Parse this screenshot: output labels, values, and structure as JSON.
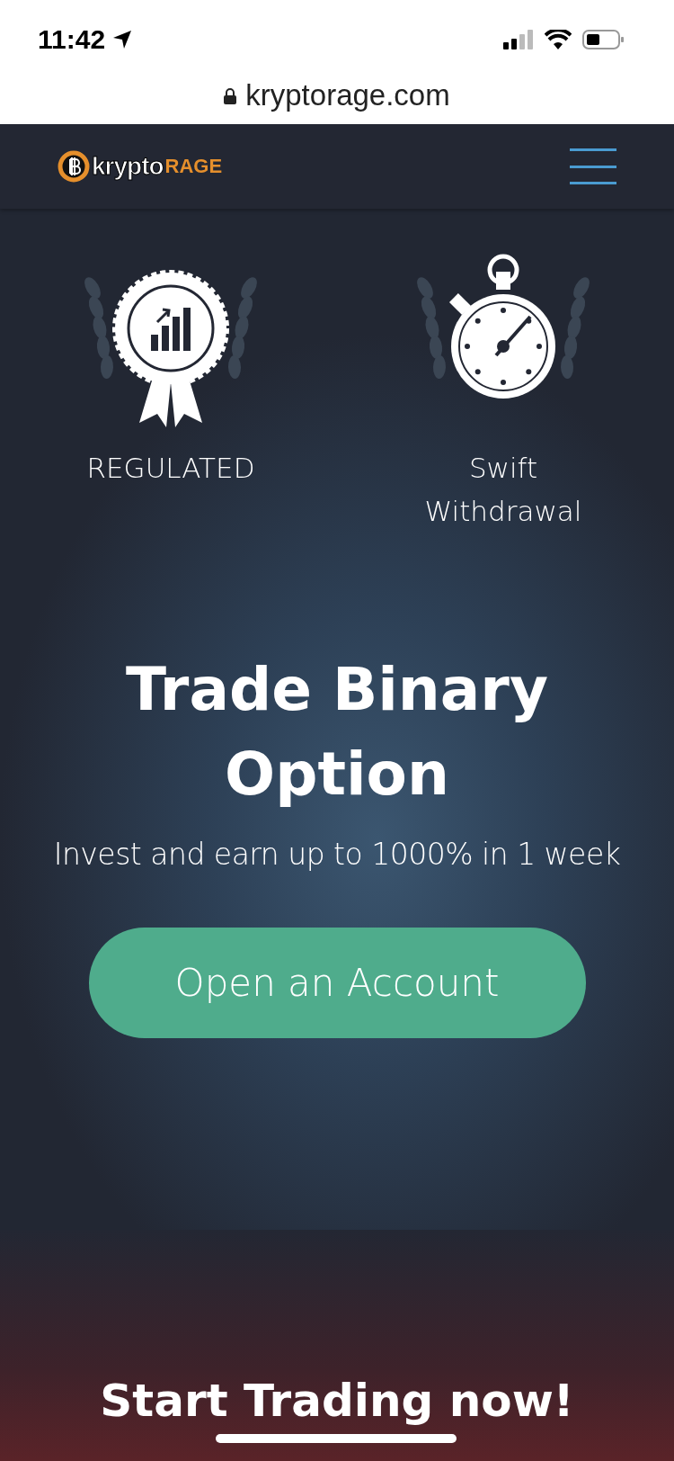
{
  "status_bar": {
    "time": "11:42"
  },
  "address_bar": {
    "url": "kryptorage.com"
  },
  "nav": {
    "logo": {
      "part_1": "krypto",
      "part_2": "RAGE"
    }
  },
  "features": [
    {
      "kind": "award",
      "label": "REGULATED"
    },
    {
      "kind": "stopwatch",
      "label": "Swift Withdrawal"
    }
  ],
  "hero": {
    "title": "Trade Binary Option",
    "subtitle": "Invest and earn up to 1000% in 1 week",
    "button": "Open an Account"
  },
  "next_section": {
    "heading": "Start Trading now!"
  }
}
